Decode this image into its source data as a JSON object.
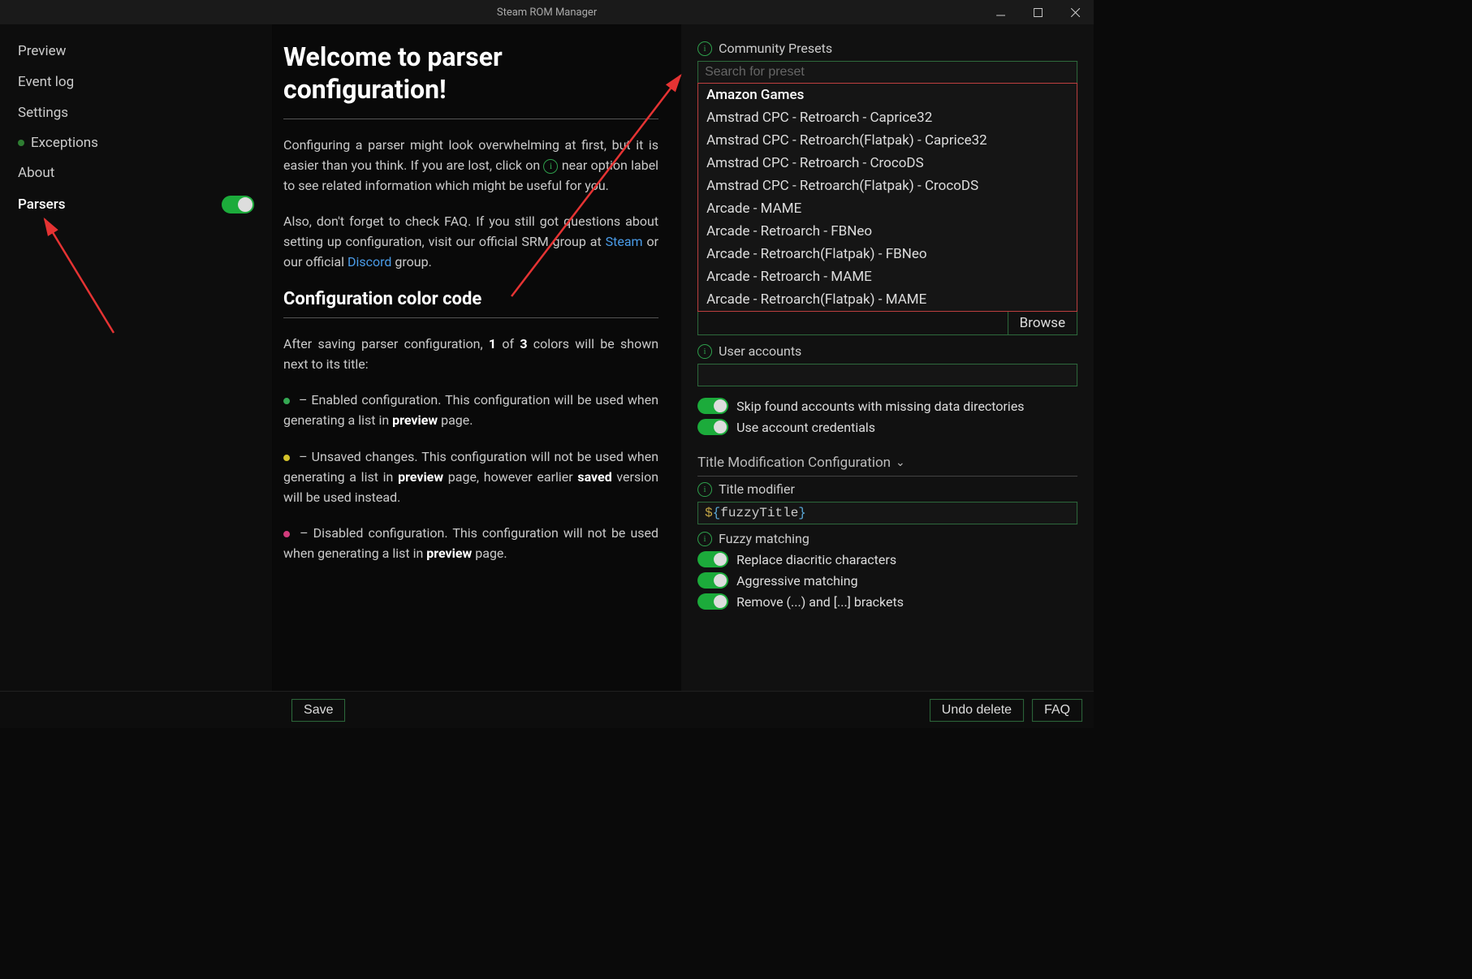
{
  "window": {
    "title": "Steam ROM Manager"
  },
  "sidebar": {
    "items": [
      {
        "label": "Preview"
      },
      {
        "label": "Event log"
      },
      {
        "label": "Settings"
      },
      {
        "label": "Exceptions",
        "sub": true
      },
      {
        "label": "About"
      },
      {
        "label": "Parsers",
        "active": true,
        "toggle": true
      }
    ]
  },
  "content": {
    "h1": "Welcome to parser configuration!",
    "p1a": "Configuring a parser might look overwhelming at first, but it is easier than you think. If you are lost, click on ",
    "p1b": " near option label to see related information which might be useful for you.",
    "p2a": "Also, don't forget to check FAQ. If you still got questions about setting up configuration, visit our official SRM group at ",
    "p2_link1": "Steam",
    "p2b": " or our official ",
    "p2_link2": "Discord",
    "p2c": " group.",
    "h2": "Configuration color code",
    "p3a": "After saving parser configuration, ",
    "p3b": "1",
    "p3c": " of ",
    "p3d": "3",
    "p3e": " colors will be shown next to its title:",
    "b1a": " – Enabled configuration. This configuration will be used when generating a list in ",
    "b1b": "preview",
    "b1c": " page.",
    "b2a": " – Unsaved changes. This configuration will not be used when generating a list in ",
    "b2b": "preview",
    "b2c": " page, however earlier ",
    "b2d": "saved",
    "b2e": " version will be used instead.",
    "b3a": " – Disabled configuration. This configuration will not be used when generating a list in ",
    "b3b": "preview",
    "b3c": " page."
  },
  "panel": {
    "presets_label": "Community Presets",
    "search_placeholder": "Search for preset",
    "presets": [
      "Amazon Games",
      "Amstrad CPC - Retroarch - Caprice32",
      "Amstrad CPC - Retroarch(Flatpak) - Caprice32",
      "Amstrad CPC - Retroarch - CrocoDS",
      "Amstrad CPC - Retroarch(Flatpak) - CrocoDS",
      "Arcade - MAME",
      "Arcade - Retroarch - FBNeo",
      "Arcade - Retroarch(Flatpak) - FBNeo",
      "Arcade - Retroarch - MAME",
      "Arcade - Retroarch(Flatpak) - MAME"
    ],
    "browse": "Browse",
    "user_accounts_label": "User accounts",
    "skip_accounts": "Skip found accounts with missing data directories",
    "use_credentials": "Use account credentials",
    "title_mod_section": "Title Modification Configuration",
    "title_modifier_label": "Title modifier",
    "title_modifier_value": "${fuzzyTitle}",
    "fuzzy_label": "Fuzzy matching",
    "replace_diacritic": "Replace diacritic characters",
    "aggressive": "Aggressive matching",
    "remove_brackets": "Remove (...) and [...] brackets"
  },
  "footer": {
    "save": "Save",
    "undo": "Undo delete",
    "faq": "FAQ"
  }
}
